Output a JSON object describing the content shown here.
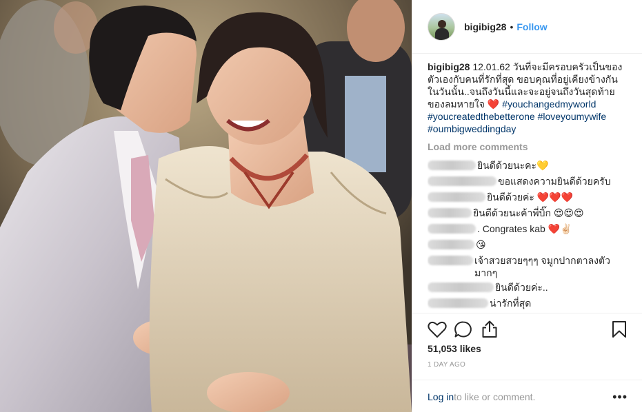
{
  "post": {
    "image_alt": "wedding photo",
    "username": "bigibig28",
    "dot": "•",
    "follow_label": "Follow"
  },
  "caption": {
    "username": "bigibig28",
    "text": " 12.01.62 วันที่จะมีครอบครัวเป็นของตัวเองกับคนที่รักที่สุด ขอบคุณที่อยู่เคียงข้างกันในวันนั้น..จนถึงวันนี้และจะอยู่จนถึงวันสุดท้ายของลมหายใจ ❤️ ",
    "tags": [
      "#youchangedmyworld",
      "#youcreatedthebetterone",
      "#loveyoumywife",
      "#oumbigweddingday"
    ]
  },
  "load_more_label": "Load more comments",
  "comments": [
    {
      "text": "ยินดีด้วยนะคะ💛",
      "blur_w": 70
    },
    {
      "text": " ขอแสดงความยินดีด้วยครับ",
      "blur_w": 100
    },
    {
      "text": " ยินดีด้วยค่ะ ❤️❤️❤️",
      "blur_w": 84
    },
    {
      "text": "ยินดีด้วยนะค้าพี่บิ๊ก 😍😍😍",
      "blur_w": 64
    },
    {
      "text": ". Congrates kab ❤️✌🏻",
      "blur_w": 70
    },
    {
      "text": " 😘",
      "blur_w": 68
    },
    {
      "text": "เจ้าสวยสวยๆๆๆ จมูกปากตาลงตัว มากๆ",
      "blur_w": 66
    },
    {
      "text": " ยินดีด้วยค่ะ..",
      "blur_w": 96
    },
    {
      "text": " น่ารักที่สุด",
      "blur_w": 88
    }
  ],
  "actions": {
    "likes": "51,053 likes",
    "time": "1 DAY AGO"
  },
  "login_bar": {
    "login_label": "Log in",
    "rest": " to like or comment.",
    "more_label": "•••"
  }
}
